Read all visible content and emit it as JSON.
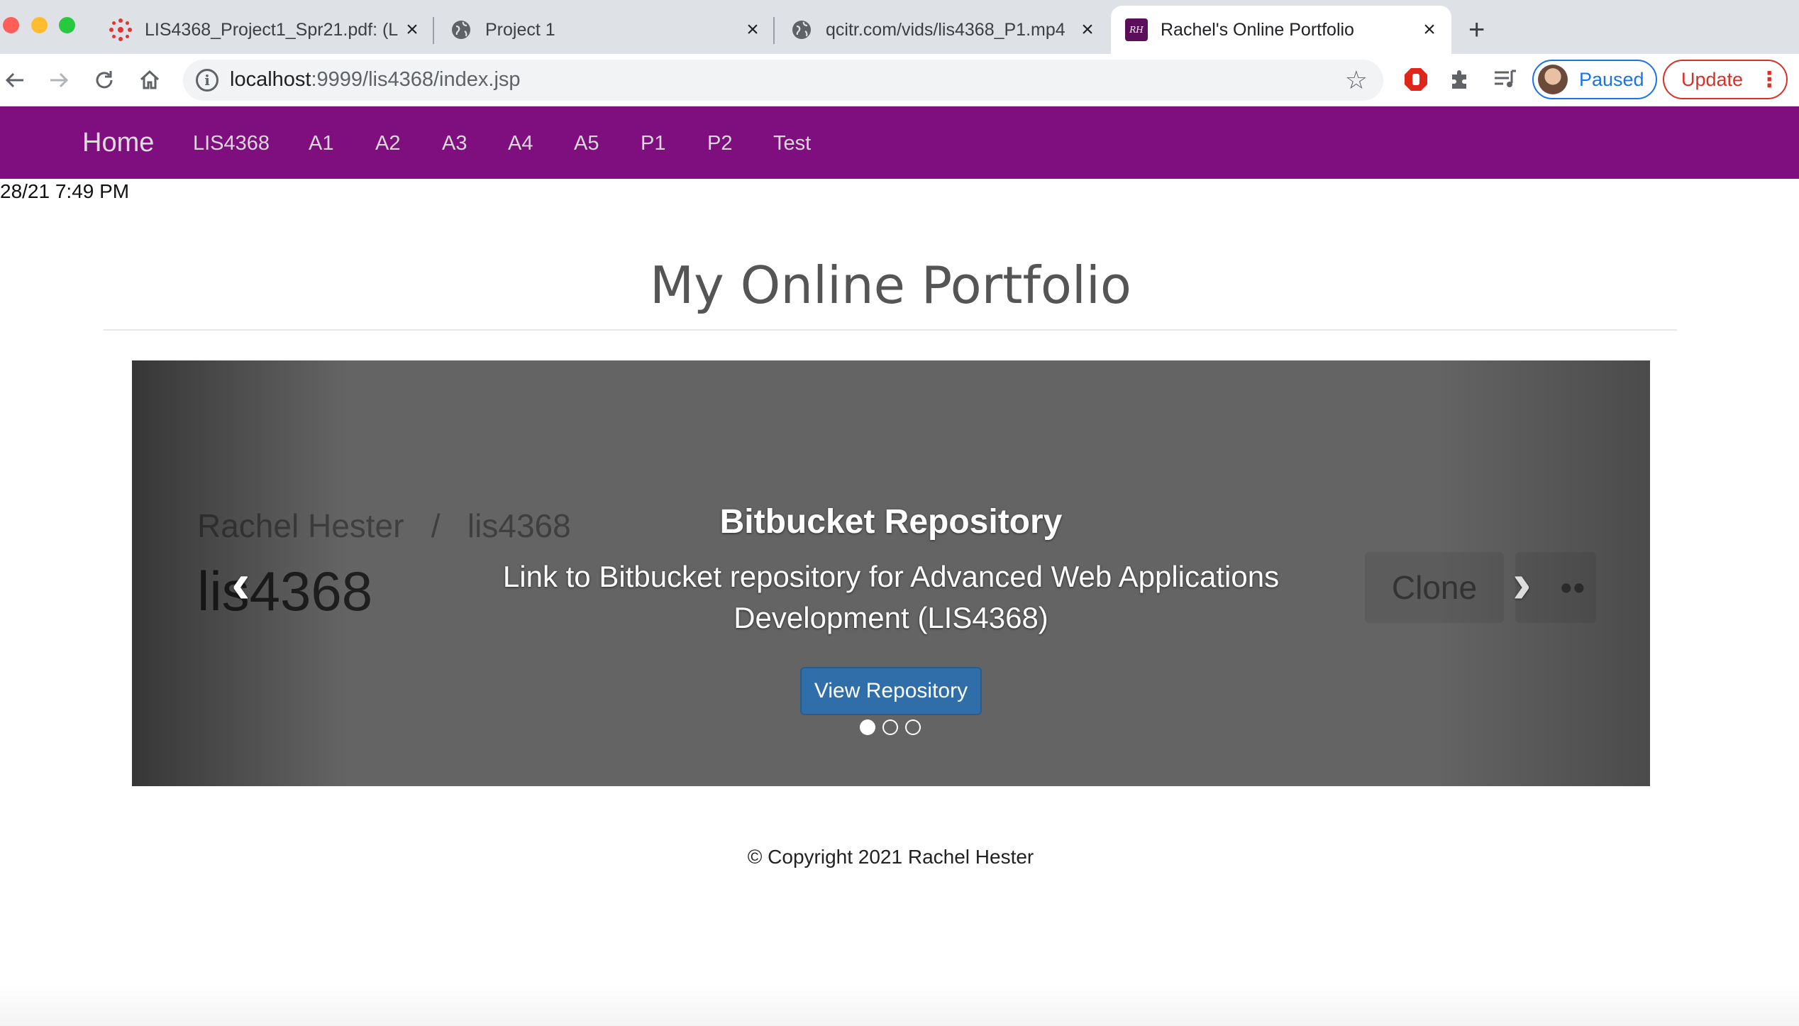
{
  "browser": {
    "tabs": [
      {
        "title": "LIS4368_Project1_Spr21.pdf: (L",
        "icon": "canvas-logo-icon"
      },
      {
        "title": "Project 1",
        "icon": "globe-icon"
      },
      {
        "title": "qcitr.com/vids/lis4368_P1.mp4",
        "icon": "globe-icon"
      },
      {
        "title": "Rachel's Online Portfolio",
        "icon": "rh-logo-icon",
        "favicon_text": "RH",
        "active": true
      }
    ],
    "new_tab": "+",
    "url_host": "localhost",
    "url_rest": ":9999/lis4368/index.jsp",
    "profile_label": "Paused",
    "update_label": "Update"
  },
  "nav": {
    "brand": "Home",
    "links": [
      "LIS4368",
      "A1",
      "A2",
      "A3",
      "A4",
      "A5",
      "P1",
      "P2",
      "Test"
    ],
    "color": "#7f0f7e"
  },
  "datetime": "28/21 7:49 PM",
  "page_title": "My Online Portfolio",
  "carousel": {
    "background_text": {
      "breadcrumb_owner": "Rachel Hester",
      "breadcrumb_sep": "/",
      "breadcrumb_repo": "lis4368",
      "repo_name": "lis4368",
      "clone": "Clone",
      "more": "••"
    },
    "caption_title": "Bitbucket Repository",
    "caption_text": "Link to Bitbucket repository for Advanced Web Applications Development (LIS4368)",
    "button_label": "View Repository",
    "slide_count": 3,
    "active_slide": 1,
    "button_color": "#2f6ea8"
  },
  "footer": "© Copyright 2021 Rachel Hester"
}
